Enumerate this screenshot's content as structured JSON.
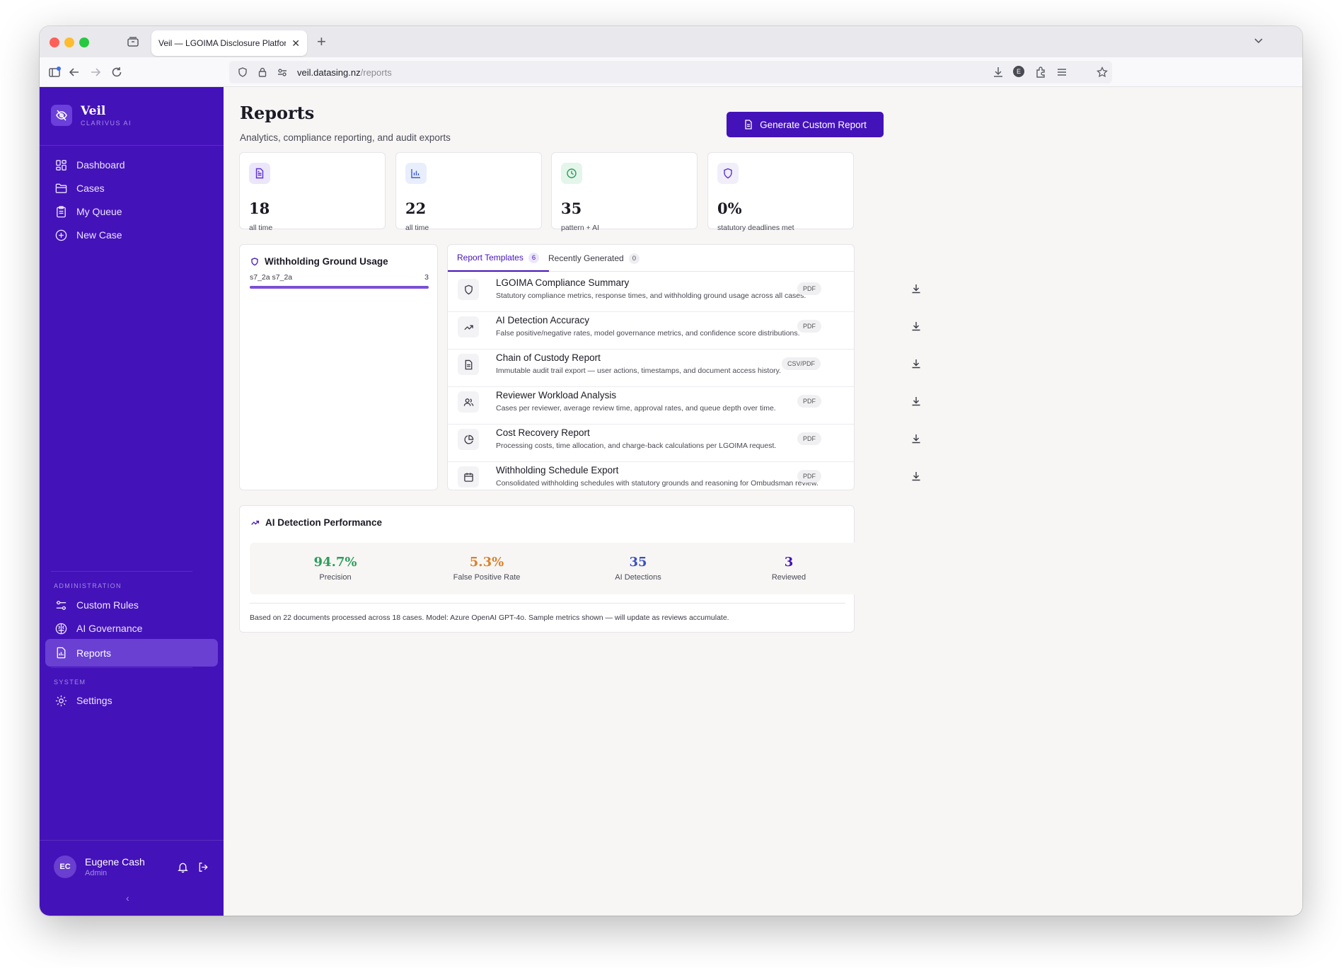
{
  "browser": {
    "tab_title": "Veil — LGOIMA Disclosure Platform",
    "url_host": "veil.datasing.nz",
    "url_path": "/reports",
    "profile_initial": "E"
  },
  "brand": {
    "name": "Veil",
    "sub": "CLARIVUS AI"
  },
  "sidebar": {
    "main": [
      {
        "label": "Dashboard",
        "icon": "dashboard-icon"
      },
      {
        "label": "Cases",
        "icon": "folder-icon"
      },
      {
        "label": "My Queue",
        "icon": "clipboard-icon"
      },
      {
        "label": "New Case",
        "icon": "plus-circle-icon"
      }
    ],
    "admin_label": "ADMINISTRATION",
    "admin": [
      {
        "label": "Custom Rules",
        "icon": "sliders-icon"
      },
      {
        "label": "AI Governance",
        "icon": "brain-icon"
      },
      {
        "label": "Reports",
        "icon": "report-icon",
        "active": true
      }
    ],
    "system_label": "SYSTEM",
    "system": [
      {
        "label": "Settings",
        "icon": "gear-icon"
      }
    ],
    "user": {
      "initials": "EC",
      "name": "Eugene Cash",
      "role": "Admin"
    }
  },
  "page": {
    "title": "Reports",
    "subtitle": "Analytics, compliance reporting, and audit exports",
    "generate_button": "Generate Custom Report"
  },
  "stats": [
    {
      "value": "18",
      "label": "all time",
      "icon": "document-icon",
      "color": "#5b2fd0"
    },
    {
      "value": "22",
      "label": "all time",
      "icon": "bar-chart-icon",
      "color": "#3b5bdb"
    },
    {
      "value": "35",
      "label": "pattern + AI",
      "icon": "clock-icon",
      "color": "#2e9d5b"
    },
    {
      "value": "0%",
      "label": "statutory deadlines met",
      "icon": "shield-icon",
      "color": "#5b2fd0"
    }
  ],
  "withholding": {
    "title": "Withholding Ground Usage",
    "items": [
      {
        "label": "s7_2a s7_2a",
        "count": "3",
        "fraction": 1.0
      }
    ]
  },
  "templates_tabs": [
    {
      "label": "Report Templates",
      "count": "6"
    },
    {
      "label": "Recently Generated",
      "count": "0"
    }
  ],
  "templates": [
    {
      "name": "LGOIMA Compliance Summary",
      "desc": "Statutory compliance metrics, response times, and withholding ground usage across all cases.",
      "format": "PDF",
      "icon": "shield-icon"
    },
    {
      "name": "AI Detection Accuracy",
      "desc": "False positive/negative rates, model governance metrics, and confidence score distributions.",
      "format": "PDF",
      "icon": "trend-up-icon"
    },
    {
      "name": "Chain of Custody Report",
      "desc": "Immutable audit trail export — user actions, timestamps, and document access history.",
      "format": "CSV/PDF",
      "icon": "document-icon"
    },
    {
      "name": "Reviewer Workload Analysis",
      "desc": "Cases per reviewer, average review time, approval rates, and queue depth over time.",
      "format": "PDF",
      "icon": "users-icon"
    },
    {
      "name": "Cost Recovery Report",
      "desc": "Processing costs, time allocation, and charge-back calculations per LGOIMA request.",
      "format": "PDF",
      "icon": "pie-chart-icon"
    },
    {
      "name": "Withholding Schedule Export",
      "desc": "Consolidated withholding schedules with statutory grounds and reasoning for Ombudsman review.",
      "format": "PDF",
      "icon": "calendar-icon"
    }
  ],
  "ai_perf": {
    "title": "AI Detection Performance",
    "metrics": [
      {
        "value": "94.7%",
        "label": "Precision",
        "color": "#2e9d5b"
      },
      {
        "value": "5.3%",
        "label": "False Positive Rate",
        "color": "#d9822b"
      },
      {
        "value": "35",
        "label": "AI Detections",
        "color": "#3b4fc4"
      },
      {
        "value": "3",
        "label": "Reviewed",
        "color": "#4412b9"
      }
    ],
    "note": "Based on 22 documents processed across 18 cases. Model: Azure OpenAI GPT-4o. Sample metrics shown — will update as reviews accumulate."
  }
}
